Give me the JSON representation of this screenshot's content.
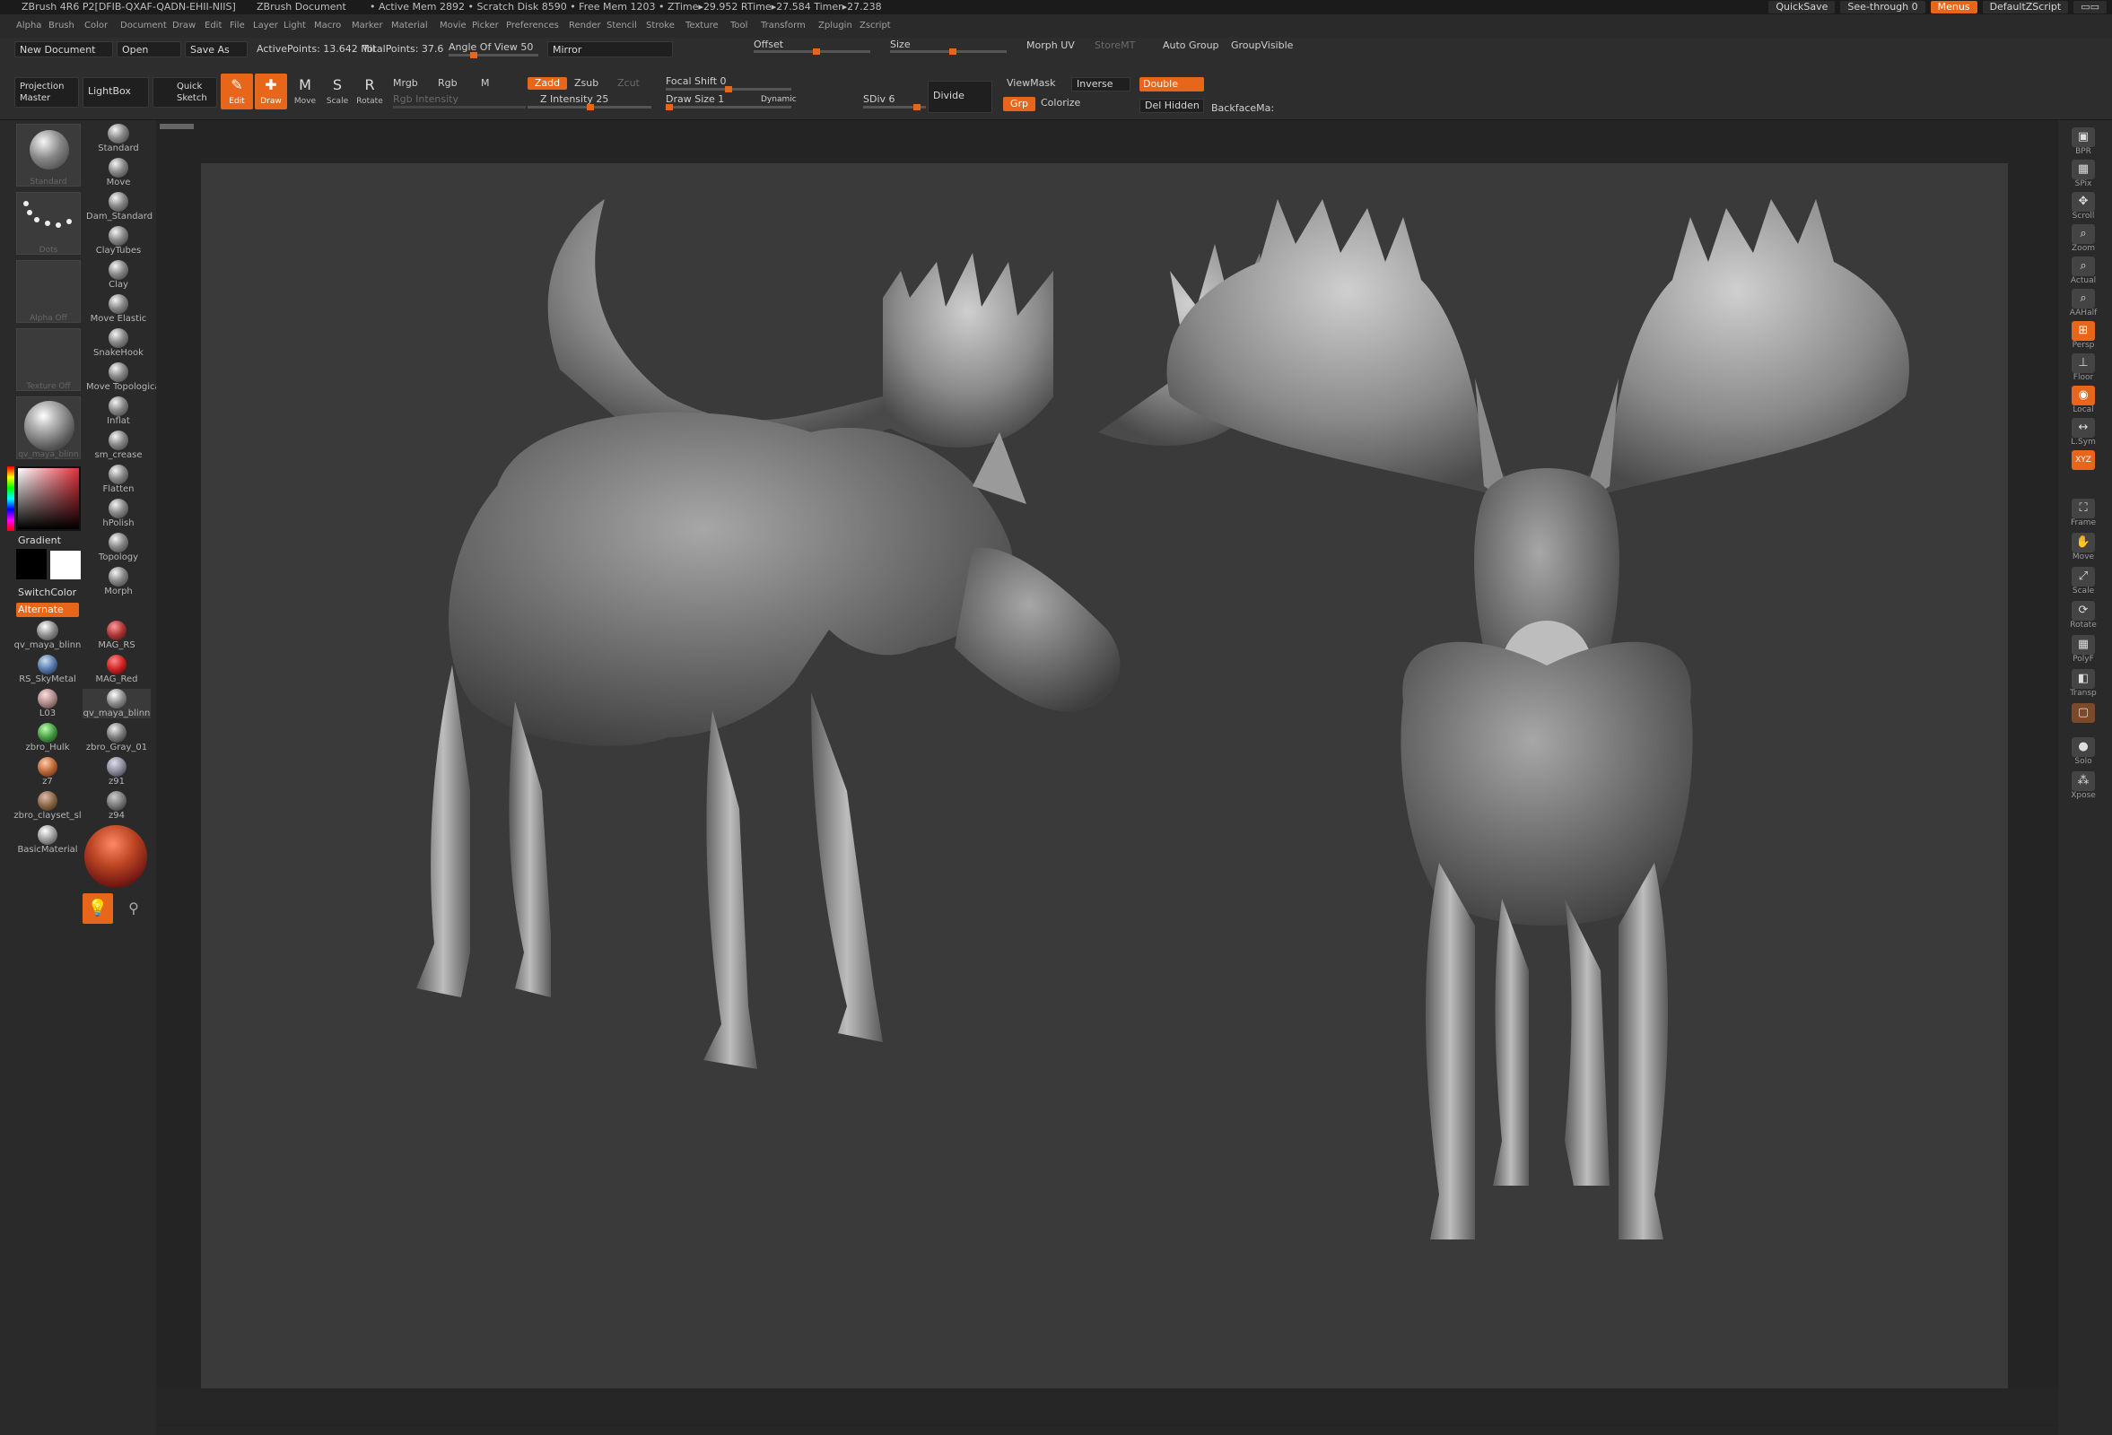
{
  "titlebar": {
    "app_title": "ZBrush 4R6 P2[DFIB-QXAF-QADN-EHII-NIIS]",
    "doc_title": "ZBrush Document",
    "stats": "• Active Mem 2892 • Scratch Disk 8590 • Free Mem 1203 • ZTime▸29.952 RTime▸27.584 Timer▸27.238",
    "quicksave": "QuickSave",
    "see_through": "See-through  0",
    "menus": "Menus",
    "default_zscript": "DefaultZScript"
  },
  "menubar": [
    "Alpha",
    "Brush",
    "Color",
    "Document",
    "Draw",
    "Edit",
    "File",
    "Layer",
    "Light",
    "Macro",
    "Marker",
    "Material",
    "Movie",
    "Picker",
    "Preferences",
    "Render",
    "Stencil",
    "Stroke",
    "Texture",
    "Tool",
    "Transform",
    "Zplugin",
    "Zscript"
  ],
  "shelf": {
    "new_document": "New Document",
    "open": "Open",
    "save_as": "Save As",
    "active_points": "ActivePoints: 13.642 Mil",
    "total_points": "TotalPoints: 37.6",
    "angle_of_view": "Angle Of View 50",
    "mirror": "Mirror",
    "offset": "Offset",
    "size": "Size",
    "morph_uv": "Morph UV",
    "store_mt": "StoreMT",
    "auto_group": "Auto Group",
    "group_visible": "GroupVisible",
    "projection_master": "Projection Master",
    "lightbox": "LightBox",
    "quick_sketch": "Quick Sketch",
    "tools": [
      {
        "label": "Edit",
        "icon": "edit-icon",
        "glyph": "✎",
        "on": true
      },
      {
        "label": "Draw",
        "icon": "draw-icon",
        "glyph": "✚",
        "on": true
      },
      {
        "label": "Move",
        "icon": "move-icon",
        "glyph": "M",
        "on": false
      },
      {
        "label": "Scale",
        "icon": "scale-icon",
        "glyph": "S",
        "on": false
      },
      {
        "label": "Rotate",
        "icon": "rotate-icon",
        "glyph": "R",
        "on": false
      }
    ],
    "mrgb": "Mrgb",
    "rgb": "Rgb",
    "m": "M",
    "rgb_intensity": "Rgb Intensity",
    "zadd": "Zadd",
    "zsub": "Zsub",
    "zcut": "Zcut",
    "z_intensity": "Z Intensity 25",
    "focal_shift": "Focal Shift 0",
    "draw_size": "Draw Size 1",
    "dynamic": "Dynamic",
    "sdiv": "SDiv 6",
    "divide": "Divide",
    "viewmask": "ViewMask",
    "inverse": "Inverse",
    "double": "Double",
    "grp": "Grp",
    "colorize": "Colorize",
    "del_hidden": "Del Hidden",
    "backface": "BackfaceMa:"
  },
  "left_tray": {
    "standard_thumb": "Standard",
    "dots_thumb": "Dots",
    "alpha_thumb": "Alpha Off",
    "texture_thumb": "Texture Off",
    "material_thumb": "qv_maya_blinn",
    "gradient": "Gradient",
    "switch_color": "SwitchColor",
    "alternate": "Alternate",
    "brushes": [
      "Standard",
      "Move",
      "Dam_Standard",
      "ClayTubes",
      "Clay",
      "Move Elastic",
      "SnakeHook",
      "Move Topologica",
      "Inflat",
      "sm_crease",
      "Flatten",
      "hPolish",
      "Topology",
      "Morph"
    ],
    "materials_left": [
      "qv_maya_blinn",
      "RS_SkyMetal",
      "L03",
      "zbro_Hulk",
      "z7",
      "zbro_clayset_sl",
      "BasicMaterial"
    ],
    "materials_right": [
      "MAG_RS",
      "MAG_Red",
      "qv_maya_blinn",
      "zbro_Gray_01",
      "z91",
      "z94"
    ]
  },
  "right_tray": [
    "BPR",
    "SPix",
    "Scroll",
    "Zoom",
    "Actual",
    "AAHalf",
    "Persp",
    "Floor",
    "Local",
    "L.Sym",
    "XYZ",
    "Frame",
    "Move",
    "Scale",
    "Rotate",
    "PolyF",
    "Transp",
    "Ghost",
    "Solo",
    "Xpose"
  ],
  "colors": {
    "accent": "#e8661a",
    "bg": "#262626",
    "canvas": "#3a3a3a"
  }
}
